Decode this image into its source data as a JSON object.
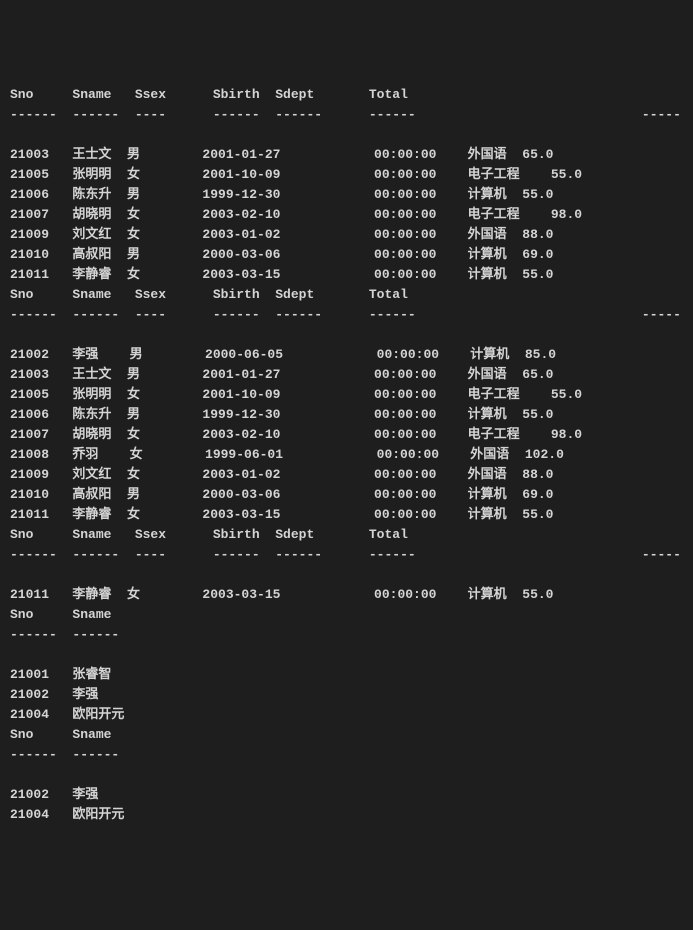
{
  "blocks": [
    {
      "cols": [
        "Sno",
        "Sname",
        "Ssex",
        "",
        "Sbirth",
        "Sdept",
        "",
        "Total"
      ],
      "widths": [
        8,
        8,
        6,
        4,
        8,
        8,
        4,
        8,
        4,
        8,
        4,
        8
      ],
      "rows": [
        [
          "21003",
          "王士文",
          "男",
          "",
          "2001-01-27",
          "",
          "",
          "00:00:00",
          "",
          "外国语",
          "65.0",
          ""
        ],
        [
          "21005",
          "张明明",
          "女",
          "",
          "2001-10-09",
          "",
          "",
          "00:00:00",
          "",
          "电子工程",
          "",
          "55.0"
        ],
        [
          "21006",
          "陈东升",
          "男",
          "",
          "1999-12-30",
          "",
          "",
          "00:00:00",
          "",
          "计算机",
          "55.0",
          ""
        ],
        [
          "21007",
          "胡晓明",
          "女",
          "",
          "2003-02-10",
          "",
          "",
          "00:00:00",
          "",
          "电子工程",
          "",
          "98.0"
        ],
        [
          "21009",
          "刘文红",
          "女",
          "",
          "2003-01-02",
          "",
          "",
          "00:00:00",
          "",
          "外国语",
          "88.0",
          ""
        ],
        [
          "21010",
          "高叔阳",
          "男",
          "",
          "2000-03-06",
          "",
          "",
          "00:00:00",
          "",
          "计算机",
          "69.0",
          ""
        ],
        [
          "21011",
          "李静睿",
          "女",
          "",
          "2003-03-15",
          "",
          "",
          "00:00:00",
          "",
          "计算机",
          "55.0",
          ""
        ]
      ]
    },
    {
      "cols": [
        "Sno",
        "Sname",
        "Ssex",
        "",
        "Sbirth",
        "Sdept",
        "",
        "Total"
      ],
      "widths": [
        8,
        8,
        6,
        4,
        8,
        8,
        4,
        8,
        4,
        8,
        4,
        8
      ],
      "rows": [
        [
          "21002",
          "李强",
          "男",
          "",
          "2000-06-05",
          "",
          "",
          "00:00:00",
          "",
          "计算机",
          "85.0",
          ""
        ],
        [
          "21003",
          "王士文",
          "男",
          "",
          "2001-01-27",
          "",
          "",
          "00:00:00",
          "",
          "外国语",
          "65.0",
          ""
        ],
        [
          "21005",
          "张明明",
          "女",
          "",
          "2001-10-09",
          "",
          "",
          "00:00:00",
          "",
          "电子工程",
          "",
          "55.0"
        ],
        [
          "21006",
          "陈东升",
          "男",
          "",
          "1999-12-30",
          "",
          "",
          "00:00:00",
          "",
          "计算机",
          "55.0",
          ""
        ],
        [
          "21007",
          "胡晓明",
          "女",
          "",
          "2003-02-10",
          "",
          "",
          "00:00:00",
          "",
          "电子工程",
          "",
          "98.0"
        ],
        [
          "21008",
          "乔羽",
          "女",
          "",
          "1999-06-01",
          "",
          "",
          "00:00:00",
          "",
          "外国语",
          "102.0",
          ""
        ],
        [
          "21009",
          "刘文红",
          "女",
          "",
          "2003-01-02",
          "",
          "",
          "00:00:00",
          "",
          "外国语",
          "88.0",
          ""
        ],
        [
          "21010",
          "高叔阳",
          "男",
          "",
          "2000-03-06",
          "",
          "",
          "00:00:00",
          "",
          "计算机",
          "69.0",
          ""
        ],
        [
          "21011",
          "李静睿",
          "女",
          "",
          "2003-03-15",
          "",
          "",
          "00:00:00",
          "",
          "计算机",
          "55.0",
          ""
        ]
      ]
    },
    {
      "cols": [
        "Sno",
        "Sname",
        "Ssex",
        "",
        "Sbirth",
        "Sdept",
        "",
        "Total"
      ],
      "widths": [
        8,
        8,
        6,
        4,
        8,
        8,
        4,
        8,
        4,
        8,
        4,
        8
      ],
      "rows": [
        [
          "21011",
          "李静睿",
          "女",
          "",
          "2003-03-15",
          "",
          "",
          "00:00:00",
          "",
          "计算机",
          "55.0",
          ""
        ]
      ]
    },
    {
      "cols": [
        "Sno",
        "Sname"
      ],
      "widths": [
        8,
        8
      ],
      "rows": [
        [
          "21001",
          "张睿智"
        ],
        [
          "21002",
          "李强"
        ],
        [
          "21004",
          "欧阳开元"
        ]
      ]
    },
    {
      "cols": [
        "Sno",
        "Sname"
      ],
      "widths": [
        8,
        8
      ],
      "rows": [
        [
          "21002",
          "李强"
        ],
        [
          "21004",
          "欧阳开元"
        ]
      ]
    }
  ]
}
